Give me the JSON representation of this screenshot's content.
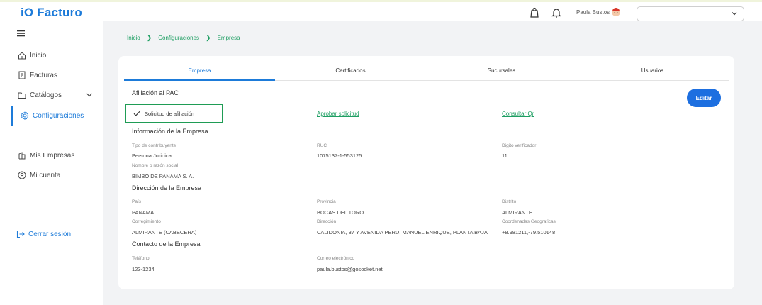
{
  "app": {
    "logo": "iO Facturo"
  },
  "header": {
    "user_name": "Paula Bustos",
    "select_value": ""
  },
  "sidebar": {
    "items": [
      {
        "label": "Inicio"
      },
      {
        "label": "Facturas"
      },
      {
        "label": "Catálogos"
      },
      {
        "label": "Configuraciones"
      },
      {
        "label": "Mis Empresas"
      },
      {
        "label": "Mi cuenta"
      }
    ],
    "logout": "Cerrar sesión"
  },
  "breadcrumb": [
    "Inicio",
    "Configuraciones",
    "Empresa"
  ],
  "tabs": [
    "Empresa",
    "Certificados",
    "Sucursales",
    "Usuarios"
  ],
  "pac": {
    "title": "Afiliación al PAC",
    "status": "Solicitud de afiliación",
    "approve_link": "Aprobar solicitud",
    "consult_link": "Consultar Qr",
    "edit_label": "Editar"
  },
  "empresa": {
    "title": "Información de la Empresa",
    "tipo_label": "Tipo de contribuyente",
    "tipo_value": "Persona Juridica",
    "ruc_label": "RUC",
    "ruc_value": "1075137-1-553125",
    "dv_label": "Digito verificador",
    "dv_value": "11",
    "nombre_label": "Nombre o razón social",
    "nombre_value": "BIMBO DE PANAMA S. A."
  },
  "direccion": {
    "title": "Dirección de la Empresa",
    "pais_label": "País",
    "pais_value": "PANAMA",
    "provincia_label": "Provincia",
    "provincia_value": "BOCAS DEL TORO",
    "distrito_label": "Distrito",
    "distrito_value": "ALMIRANTE",
    "correg_label": "Corregimiento",
    "correg_value": "ALMIRANTE (CABECERA)",
    "dir_label": "Dirección",
    "dir_value": "CALIDONIA, 37 Y AVENIDA PERU, MANUEL ENRIQUE, PLANTA BAJA",
    "coord_label": "Coordenadas Geograficas",
    "coord_value": "+8.981211,-79.510148"
  },
  "contacto": {
    "title": "Contacto de la Empresa",
    "tel_label": "Teléfono",
    "tel_value": "123-1234",
    "email_label": "Correo electrónico",
    "email_value": "paula.bustos@gosocket.net"
  },
  "colors": {
    "primary": "#1d7bd9",
    "green": "#1d9e62",
    "box_green": "#1f9c55",
    "edit_button": "#1d6fe0"
  }
}
